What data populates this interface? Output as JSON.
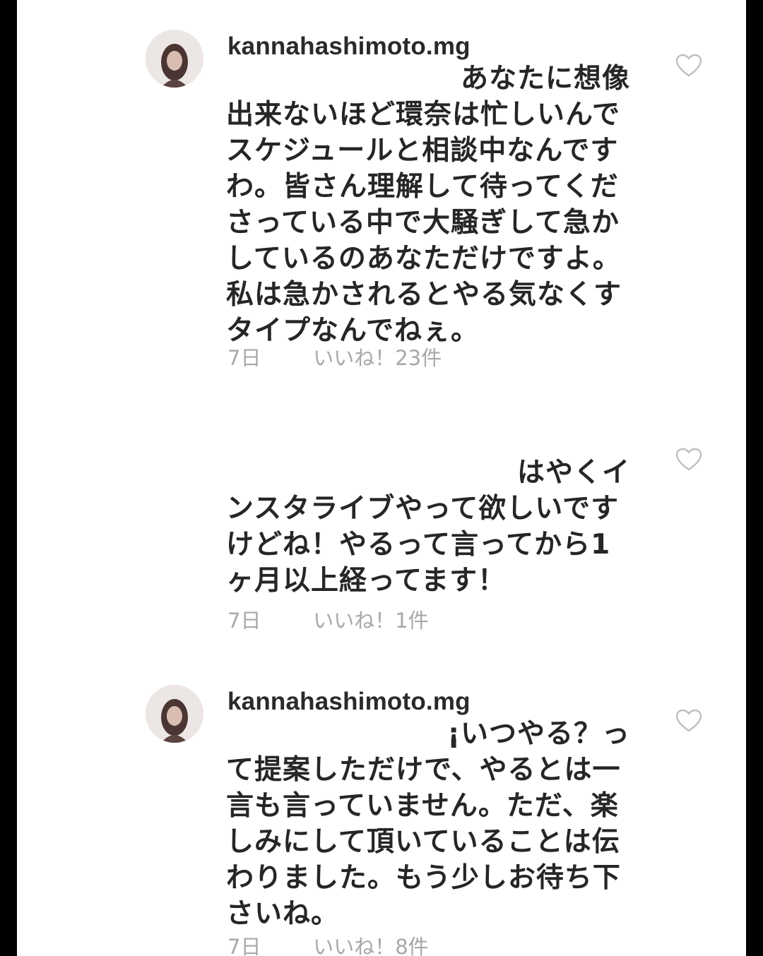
{
  "colors": {
    "background": "#ffffff",
    "frame": "#000000",
    "text": "#262626",
    "meta": "#a8a8a8"
  },
  "comments": [
    {
      "username": "kannahashimoto.mg",
      "has_avatar": true,
      "lines": [
        "あなたに想像",
        "出来ないほど環奈は忙しいんで",
        "スケジュールと相談中なんです",
        "わ。皆さん理解して待ってくだ",
        "さっている中で大騒ぎして急か",
        "しているのあなただけですよ。",
        "私は急かされるとやる気なくす",
        "タイプなんでねぇ。"
      ],
      "age": "7日",
      "likes": "いいね！23件",
      "heart_icon": "heart-outline-icon"
    },
    {
      "username": "",
      "has_avatar": false,
      "lines": [
        "はやくイ",
        "ンスタライブやって欲しいです",
        "けどね！やるって言ってから1",
        "ヶ月以上経ってます！"
      ],
      "age": "7日",
      "likes": "いいね！1件",
      "heart_icon": "heart-outline-icon"
    },
    {
      "username": "kannahashimoto.mg",
      "has_avatar": true,
      "lines": [
        "¡いつやる？っ",
        "て提案しただけで、やるとは一",
        "言も言っていません。ただ、楽",
        "しみにして頂いていることは伝",
        "わりました。もう少しお待ち下",
        "さいね。"
      ],
      "age": "7日",
      "likes": "いいね！8件",
      "heart_icon": "heart-outline-icon"
    }
  ]
}
